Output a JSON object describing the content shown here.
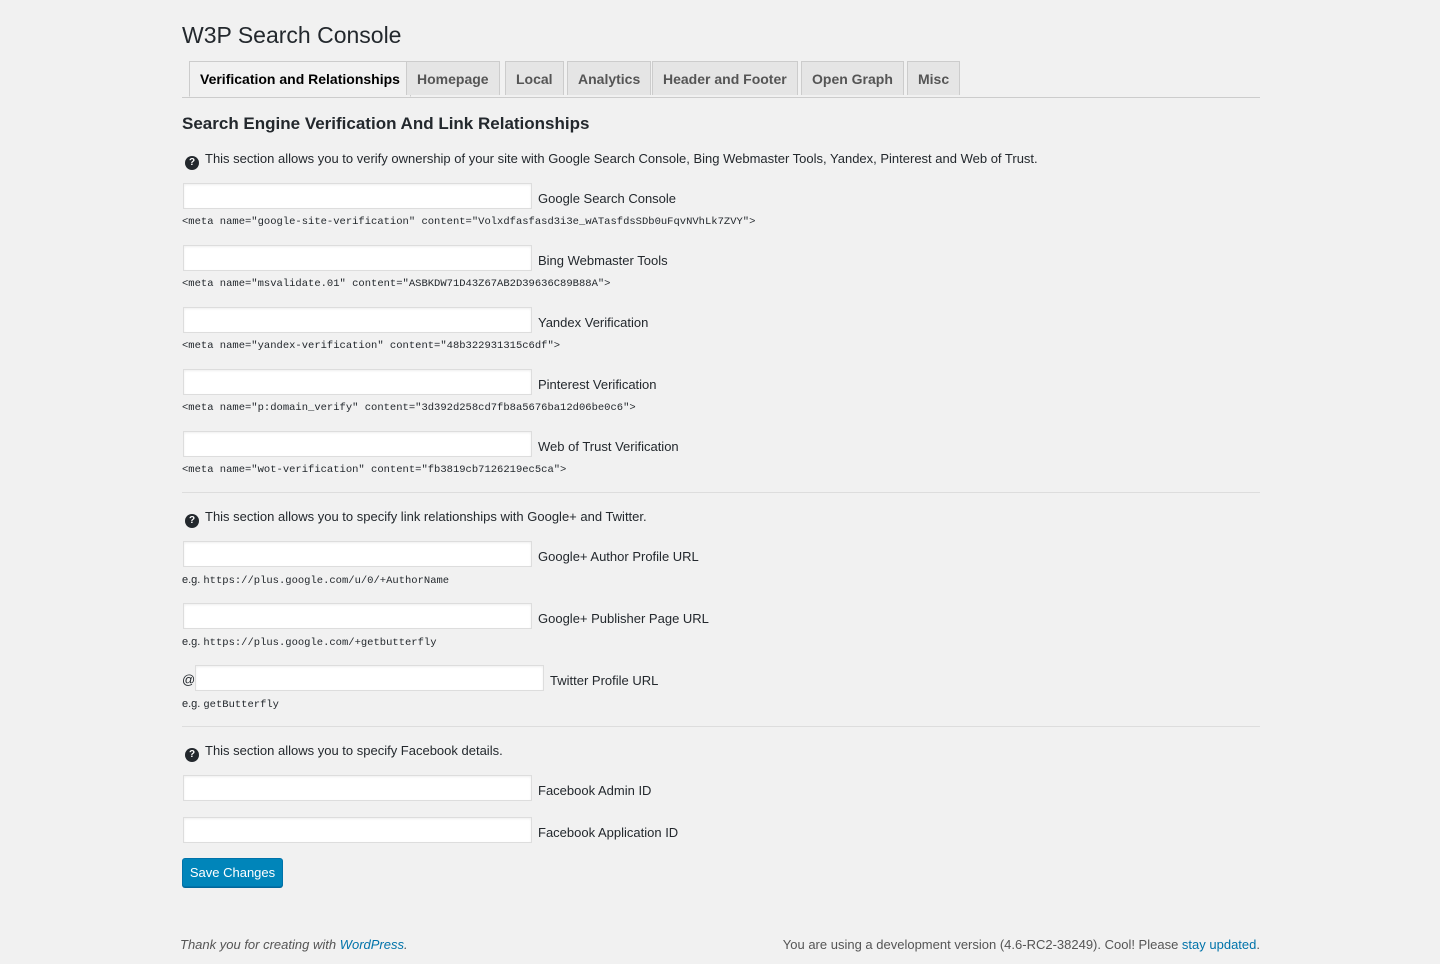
{
  "page": {
    "title": "W3P Search Console"
  },
  "tabs": [
    {
      "label": "Verification and Relationships",
      "active": true
    },
    {
      "label": "Homepage",
      "active": false
    },
    {
      "label": "Local",
      "active": false
    },
    {
      "label": "Analytics",
      "active": false
    },
    {
      "label": "Header and Footer",
      "active": false
    },
    {
      "label": "Open Graph",
      "active": false
    },
    {
      "label": "Misc",
      "active": false
    }
  ],
  "section": {
    "title": "Search Engine Verification And Link Relationships",
    "verification_info": "This section allows you to verify ownership of your site with Google Search Console, Bing Webmaster Tools, Yandex, Pinterest and Web of Trust.",
    "relationships_info": "This section allows you to specify link relationships with Google+ and Twitter.",
    "facebook_info": "This section allows you to specify Facebook details."
  },
  "verification_fields": [
    {
      "label": "Google Search Console",
      "value": "",
      "hint": "<meta name=\"google-site-verification\" content=\"Volxdfasfasd3i3e_wATasfdsSDb0uFqvNVhLk7ZVY\">"
    },
    {
      "label": "Bing Webmaster Tools",
      "value": "",
      "hint": "<meta name=\"msvalidate.01\" content=\"ASBKDW71D43Z67AB2D39636C89B88A\">"
    },
    {
      "label": "Yandex Verification",
      "value": "",
      "hint": "<meta name=\"yandex-verification\" content=\"48b322931315c6df\">"
    },
    {
      "label": "Pinterest Verification",
      "value": "",
      "hint": "<meta name=\"p:domain_verify\" content=\"3d392d258cd7fb8a5676ba12d06be0c6\">"
    },
    {
      "label": "Web of Trust Verification",
      "value": "",
      "hint": "<meta name=\"wot-verification\" content=\"fb3819cb7126219ec5ca\">"
    }
  ],
  "relationship_fields": [
    {
      "label": "Google+ Author Profile URL",
      "value": "",
      "eg_prefix": "e.g.",
      "eg": "https://plus.google.com/u/0/+AuthorName"
    },
    {
      "label": "Google+ Publisher Page URL",
      "value": "",
      "eg_prefix": "e.g.",
      "eg": "https://plus.google.com/+getbutterfly"
    },
    {
      "label": "Twitter Profile URL",
      "value": "",
      "at": "@",
      "eg_prefix": "e.g.",
      "eg": "getButterfly"
    }
  ],
  "facebook_fields": [
    {
      "label": "Facebook Admin ID",
      "value": ""
    },
    {
      "label": "Facebook Application ID",
      "value": ""
    }
  ],
  "buttons": {
    "save": "Save Changes"
  },
  "footer": {
    "left_text": "Thank you for creating with ",
    "left_link": "WordPress",
    "left_suffix": ".",
    "right_text": "You are using a development version (4.6-RC2-38249). Cool! Please ",
    "right_link": "stay updated",
    "right_suffix": "."
  },
  "colors": {
    "primary_button": "#0085ba",
    "link": "#0073aa",
    "background": "#f1f1f1"
  }
}
